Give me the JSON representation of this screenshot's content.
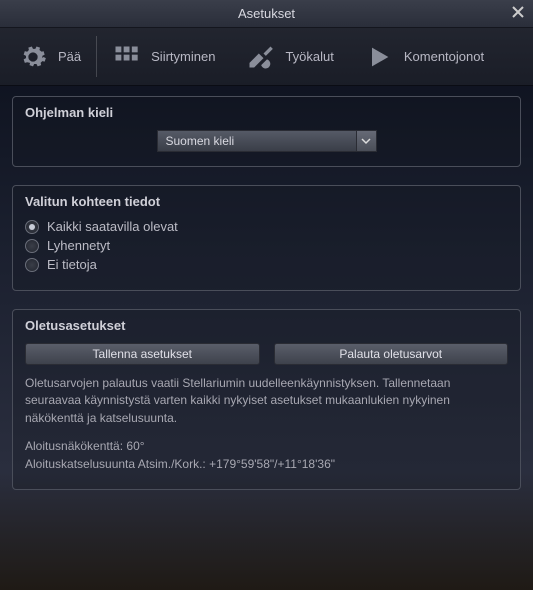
{
  "window": {
    "title": "Asetukset"
  },
  "tabs": {
    "main": "Pää",
    "navigation": "Siirtyminen",
    "tools": "Työkalut",
    "scripts": "Komentojonot"
  },
  "group_language": {
    "title": "Ohjelman kieli",
    "selected": "Suomen kieli"
  },
  "group_selected_info": {
    "title": "Valitun kohteen tiedot",
    "opt_all": "Kaikki saatavilla olevat",
    "opt_short": "Lyhennetyt",
    "opt_none": "Ei tietoja"
  },
  "group_defaults": {
    "title": "Oletusasetukset",
    "btn_save": "Tallenna asetukset",
    "btn_restore": "Palauta oletusarvot",
    "description": "Oletusarvojen palautus vaatii Stellariumin uudelleenkäynnistyksen. Tallennetaan seuraavaa käynnistystä varten kaikki nykyiset asetukset mukaanlukien nykyinen näkökenttä ja katselusuunta.",
    "line_fov": "Aloitusnäkökenttä: 60°",
    "line_direction": "Aloituskatselusuunta Atsim./Kork.: +179°59'58\"/+11°18'36\""
  }
}
